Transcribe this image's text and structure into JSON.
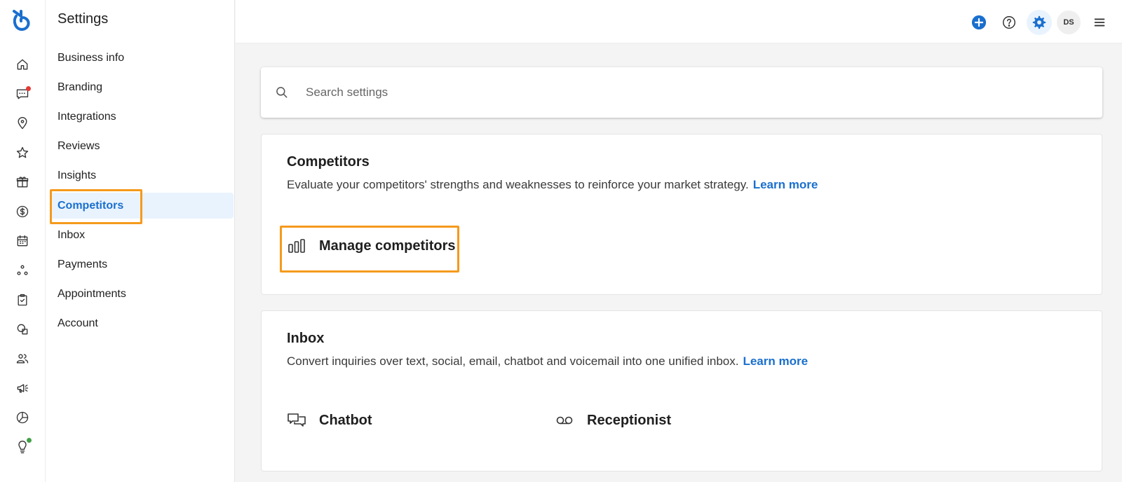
{
  "nav": {
    "title": "Settings",
    "items": [
      {
        "label": "Business info"
      },
      {
        "label": "Branding"
      },
      {
        "label": "Integrations"
      },
      {
        "label": "Reviews"
      },
      {
        "label": "Insights"
      },
      {
        "label": "Competitors",
        "active": true
      },
      {
        "label": "Inbox"
      },
      {
        "label": "Payments"
      },
      {
        "label": "Appointments"
      },
      {
        "label": "Account"
      }
    ]
  },
  "rail": {
    "icons": [
      "home-icon",
      "chat-icon",
      "location-pin-icon",
      "star-icon",
      "gift-icon",
      "dollar-icon",
      "calendar-icon",
      "nodes-icon",
      "task-icon",
      "shapes-icon",
      "people-icon",
      "megaphone-icon",
      "pie-chart-icon",
      "lightbulb-icon"
    ],
    "badge_color_red": "#e53935",
    "badge_color_green": "#43a047"
  },
  "topbar": {
    "avatar_initials": "DS",
    "accent_color": "#1a6fce"
  },
  "search": {
    "placeholder": "Search settings"
  },
  "competitors_card": {
    "title": "Competitors",
    "description": "Evaluate your competitors' strengths and weaknesses to reinforce your market strategy.",
    "learn_more": "Learn more",
    "features": [
      {
        "label": "Manage competitors",
        "icon": "bar-chart-icon"
      }
    ]
  },
  "inbox_card": {
    "title": "Inbox",
    "description": "Convert inquiries over text, social, email, chatbot and voicemail into one unified inbox.",
    "learn_more": "Learn more",
    "features": [
      {
        "label": "Chatbot",
        "icon": "chat-bubbles-icon"
      },
      {
        "label": "Receptionist",
        "icon": "voicemail-icon"
      }
    ]
  },
  "highlight_color": "#f59a1c"
}
